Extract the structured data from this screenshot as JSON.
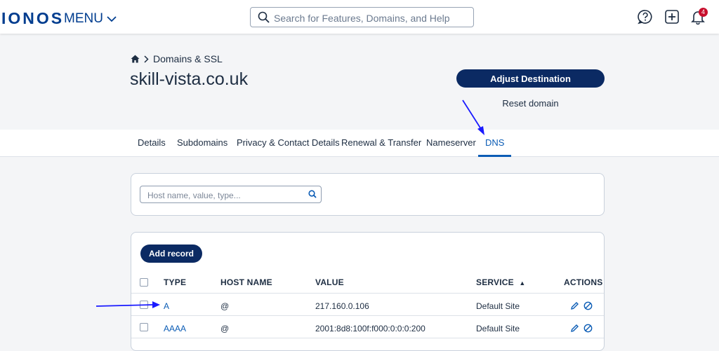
{
  "header": {
    "logo": "IONOS",
    "menu_label": "MENU",
    "search_placeholder": "Search for Features, Domains, and Help",
    "notification_count": "4"
  },
  "breadcrumb": {
    "section": "Domains & SSL"
  },
  "page": {
    "title": "skill-vista.co.uk",
    "adjust_destination": "Adjust Destination",
    "reset_domain": "Reset domain"
  },
  "tabs": [
    {
      "label": "Details"
    },
    {
      "label": "Subdomains"
    },
    {
      "label": "Privacy & Contact Details"
    },
    {
      "label": "Renewal & Transfer"
    },
    {
      "label": "Nameserver"
    },
    {
      "label": "DNS",
      "active": true
    }
  ],
  "filter": {
    "placeholder": "Host name, value, type..."
  },
  "records": {
    "add_label": "Add record",
    "columns": {
      "type": "TYPE",
      "host": "HOST NAME",
      "value": "VALUE",
      "service": "SERVICE",
      "actions": "ACTIONS"
    },
    "sort_indicator": "▲",
    "rows": [
      {
        "type": "A",
        "host": "@",
        "value": "217.160.0.106",
        "service": "Default Site"
      },
      {
        "type": "AAAA",
        "host": "@",
        "value": "2001:8d8:100f:f000:0:0:0:200",
        "service": "Default Site"
      }
    ]
  },
  "colors": {
    "brand": "#003d8f",
    "primary_button": "#0b2a63",
    "link": "#0b5cb5",
    "annotation_arrow": "#1a1aff",
    "badge": "#c8102e"
  },
  "icons": [
    "chevron-down-icon",
    "search-icon",
    "help-icon",
    "add-icon",
    "bell-icon",
    "home-icon",
    "chevron-right-icon",
    "edit-icon",
    "delete-icon",
    "sort-up-icon"
  ]
}
